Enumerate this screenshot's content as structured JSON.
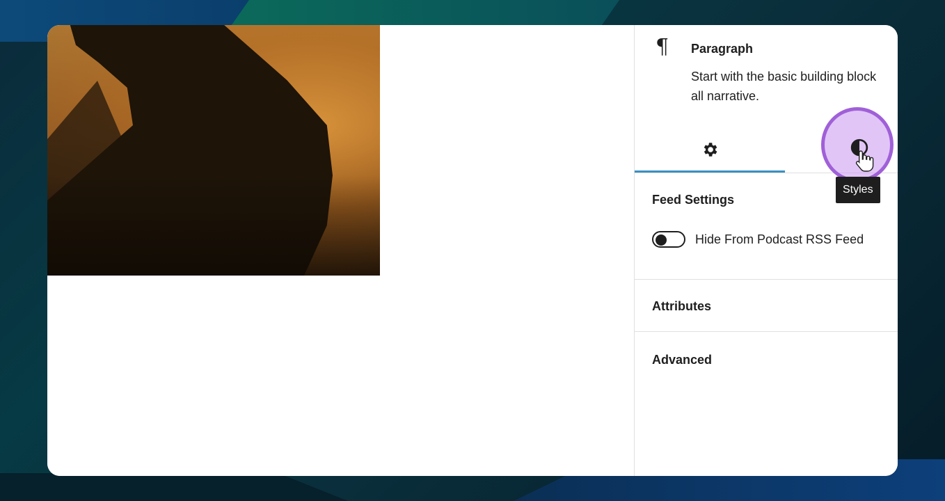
{
  "block_card": {
    "title": "Paragraph",
    "description_line1": "Start with the basic building block",
    "description_line2": "all narrative."
  },
  "tabs": {
    "settings_icon": "gear-icon",
    "styles_icon": "half-circle-contrast-icon",
    "styles_tooltip": "Styles"
  },
  "panels": {
    "feed_settings": {
      "title": "Feed Settings",
      "toggle_label": "Hide From Podcast RSS Feed",
      "toggle_on": false
    },
    "attributes": {
      "title": "Attributes"
    },
    "advanced": {
      "title": "Advanced"
    }
  },
  "colors": {
    "active_tab_indicator": "#3a8fc4",
    "highlight_ring": "#a060d8"
  }
}
